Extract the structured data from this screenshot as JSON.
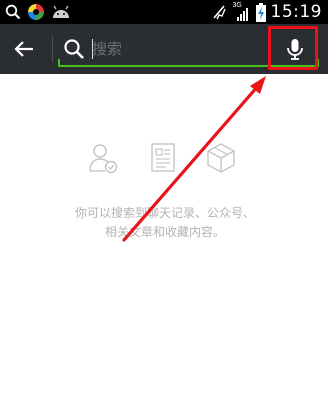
{
  "status_bar": {
    "time": "15:19",
    "network": "3G",
    "icons": [
      "search-icon",
      "app-icon",
      "android-icon",
      "signal-muted-icon",
      "signal-icon",
      "battery-charging-icon"
    ]
  },
  "search": {
    "placeholder": "搜索",
    "value": "",
    "back_icon": "back-arrow-icon",
    "search_icon": "search-icon",
    "voice_icon": "microphone-icon"
  },
  "content": {
    "category_icons": [
      "contact-icon",
      "article-icon",
      "box-icon"
    ],
    "hint_line_1": "你可以搜索到聊天记录、公众号、",
    "hint_line_2": "相关文章和收藏内容。"
  },
  "annotation": {
    "color": "#e8141a"
  },
  "colors": {
    "header_bg": "#2a2d31",
    "accent_green": "#45c01a",
    "hint_gray": "#b3b3b3"
  }
}
